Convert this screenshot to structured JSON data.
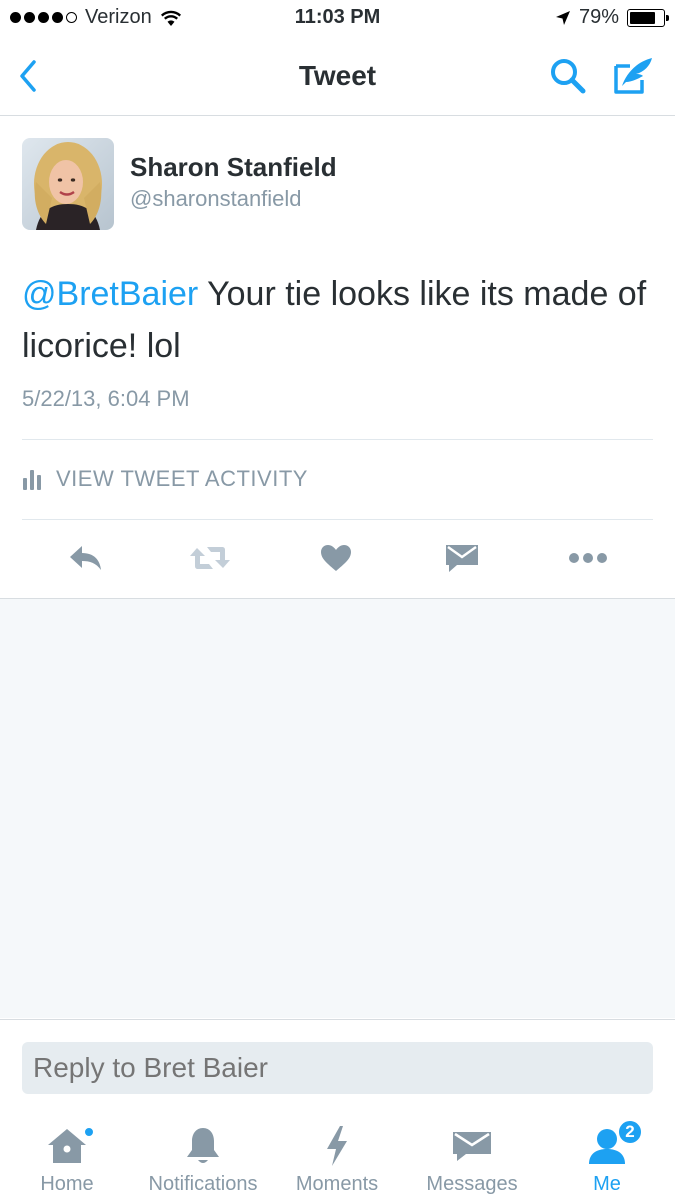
{
  "status_bar": {
    "carrier": "Verizon",
    "time": "11:03 PM",
    "battery_percent": "79%",
    "battery_level": 0.79,
    "signal_bars_filled": 4,
    "signal_bars_total": 5
  },
  "nav": {
    "title": "Tweet",
    "back_icon": "chevron-left-icon",
    "search_icon": "search-icon",
    "compose_icon": "compose-icon"
  },
  "tweet": {
    "user_name": "Sharon Stanfield",
    "user_handle": "@sharonstanfield",
    "mention": "@BretBaier",
    "text": " Your tie looks like its made of licorice! lol",
    "timestamp": "5/22/13, 6:04 PM",
    "activity_label": "VIEW TWEET ACTIVITY"
  },
  "actions": [
    "reply-icon",
    "retweet-icon",
    "like-icon",
    "direct-message-icon",
    "more-icon"
  ],
  "reply": {
    "placeholder": "Reply to Bret Baier"
  },
  "tabs": [
    {
      "label": "Home",
      "icon": "home-icon",
      "has_dot": true
    },
    {
      "label": "Notifications",
      "icon": "bell-icon"
    },
    {
      "label": "Moments",
      "icon": "lightning-icon"
    },
    {
      "label": "Messages",
      "icon": "envelope-icon"
    },
    {
      "label": "Me",
      "icon": "person-icon",
      "badge": "2",
      "active": true
    }
  ],
  "colors": {
    "accent": "#1da1f2",
    "text": "#292f33",
    "muted": "#8899a6",
    "icon_gray": "#8899a6",
    "background_gray": "#f5f8fa"
  }
}
